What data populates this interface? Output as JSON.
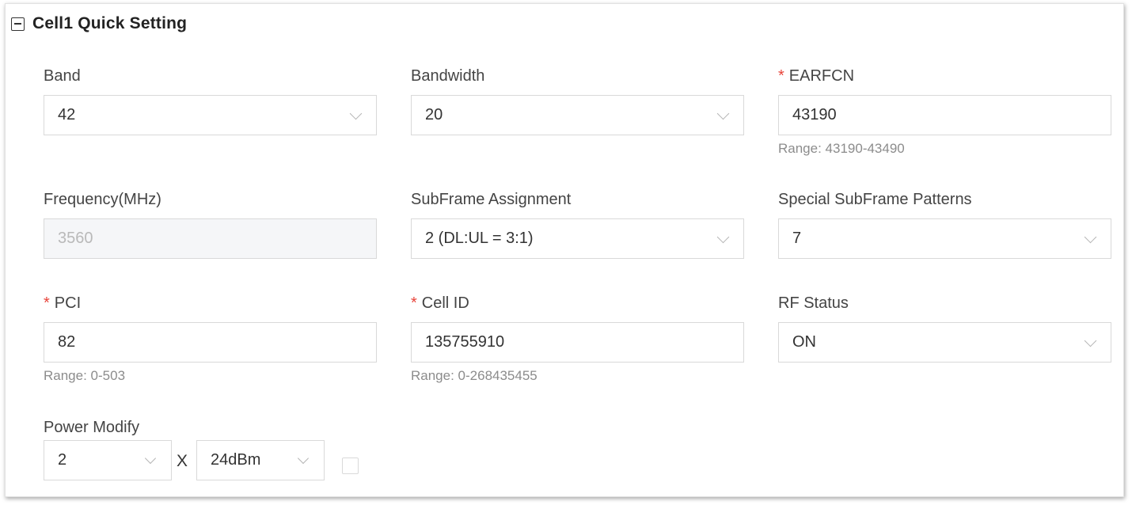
{
  "section": {
    "title": "Cell1 Quick Setting",
    "collapse_icon": "minus-square-icon"
  },
  "fields": {
    "band": {
      "label": "Band",
      "value": "42"
    },
    "bandwidth": {
      "label": "Bandwidth",
      "value": "20"
    },
    "earfcn": {
      "required": "*",
      "label": "EARFCN",
      "value": "43190",
      "hint": "Range: 43190-43490"
    },
    "frequency": {
      "label": "Frequency(MHz)",
      "value": "3560"
    },
    "subframe_assignment": {
      "label": "SubFrame Assignment",
      "value": "2 (DL:UL = 3:1)"
    },
    "special_subframe": {
      "label": "Special SubFrame Patterns",
      "value": "7"
    },
    "pci": {
      "required": "*",
      "label": "PCI",
      "value": "82",
      "hint": "Range: 0-503"
    },
    "cell_id": {
      "required": "*",
      "label": "Cell ID",
      "value": "135755910",
      "hint": "Range: 0-268435455"
    },
    "rf_status": {
      "label": "RF Status",
      "value": "ON"
    }
  },
  "power_modify": {
    "label": "Power Modify",
    "multiplier": "2",
    "times_symbol": "X",
    "power": "24dBm",
    "checkbox_checked": false
  },
  "colors": {
    "required_star": "#e8443a",
    "border": "#d9d9d9",
    "disabled_bg": "#f5f6f8"
  }
}
